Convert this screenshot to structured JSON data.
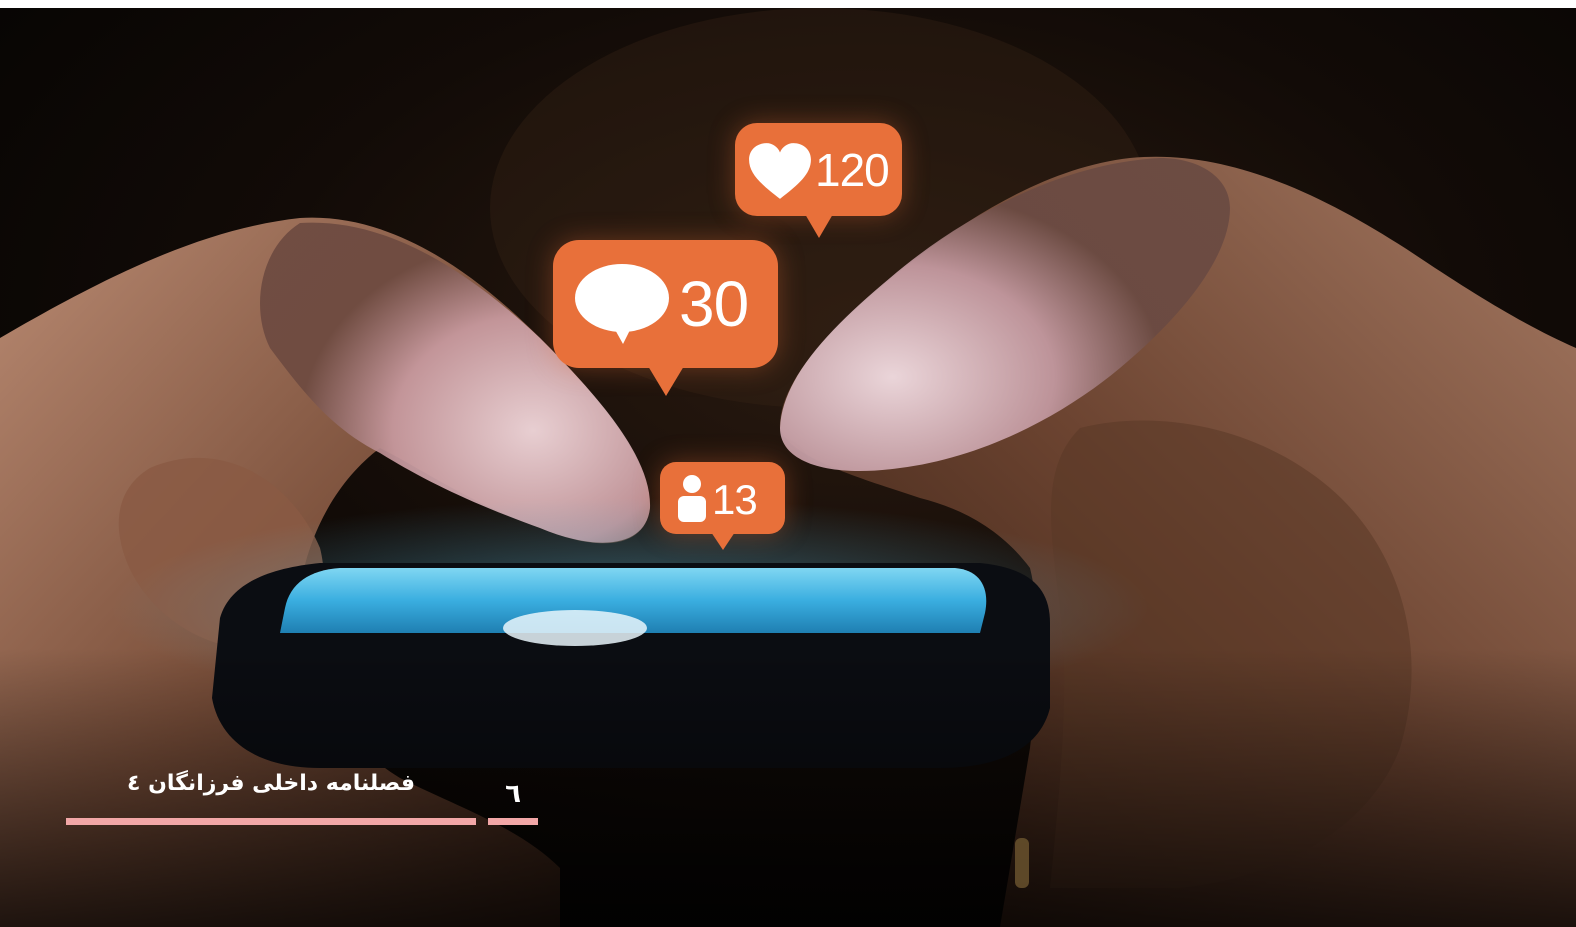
{
  "photo": {
    "subject": "hands-holding-smartphone",
    "notifications": {
      "likes": {
        "icon": "heart-icon",
        "count": "120"
      },
      "comments": {
        "icon": "speech-bubble-icon",
        "count": "30"
      },
      "followers": {
        "icon": "person-icon",
        "count": "13"
      }
    },
    "colors": {
      "bubble": "#e8703a",
      "screen_glow": "#44b8e6",
      "background": "#090604"
    }
  },
  "footer": {
    "title": "فصلنامه داخلی فرزانگان ٤",
    "page_number": "٦",
    "rule_color": "#f2a7a7"
  }
}
